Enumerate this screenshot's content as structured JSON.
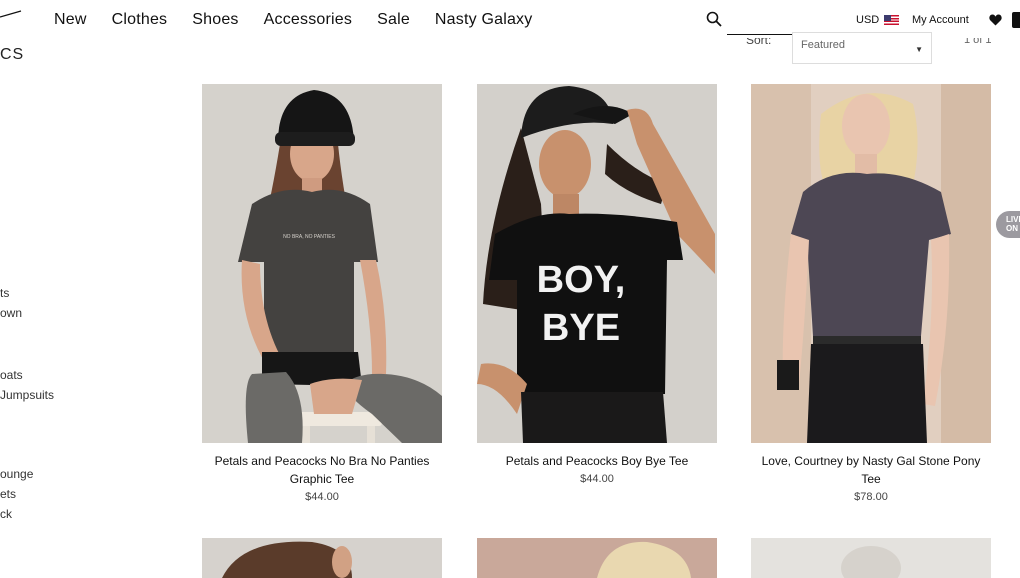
{
  "header": {
    "nav": [
      "New",
      "Clothes",
      "Shoes",
      "Accessories",
      "Sale",
      "Nasty Galaxy"
    ],
    "search": {
      "value": "",
      "icon": "search-icon"
    },
    "currency": "USD",
    "account": "My Account"
  },
  "toolbar": {
    "category_heading": "CS",
    "sort_label": "Sort:",
    "sort_value": "Featured",
    "pager": "1 of 1"
  },
  "sidebar": {
    "items": [
      "ts",
      "own",
      "oats",
      "Jumpsuits",
      "ounge",
      "ets",
      "ck"
    ]
  },
  "products": [
    {
      "name": "Petals and Peacocks No Bra No Panties Graphic Tee",
      "price": "$44.00",
      "shirt_text": "NO BRA, NO PANTIES"
    },
    {
      "name": "Petals and Peacocks Boy Bye Tee",
      "price": "$44.00",
      "shirt_text": "BOY, BYE"
    },
    {
      "name": "Love, Courtney by Nasty Gal Stone Pony Tee",
      "price": "$78.00",
      "shirt_text": ""
    }
  ],
  "live_chat": "LIVE ON",
  "colors": {
    "text": "#111111",
    "price": "#444444",
    "photo_bg_1": "#d9d6d1",
    "photo_bg_2": "#d3d0cb",
    "photo_bg_3": "#e1cfc0",
    "live_chat_bg": "#9c9aa0"
  }
}
